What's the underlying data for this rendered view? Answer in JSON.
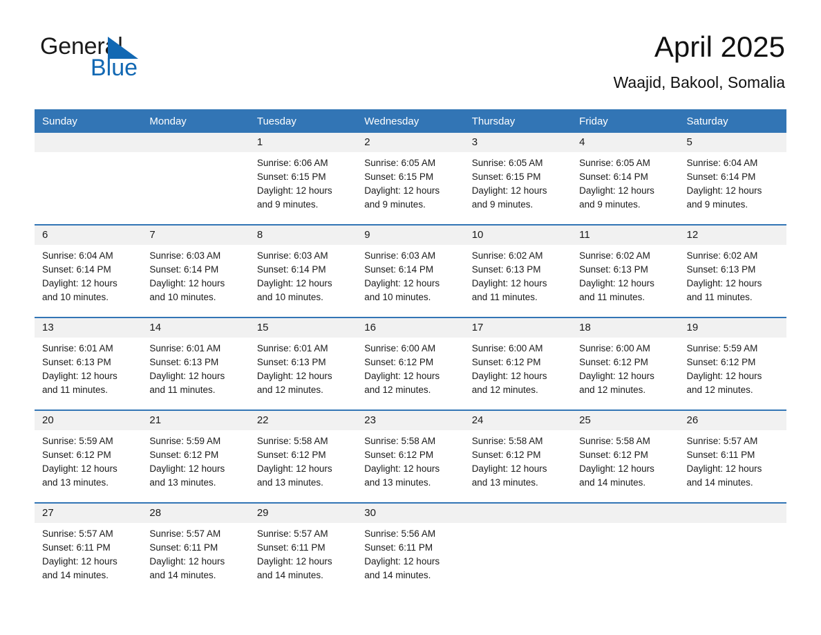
{
  "brand": {
    "name_part1": "General",
    "name_part2": "Blue",
    "triangle_color": "#1268b3",
    "logo_icon": "general-blue-logo"
  },
  "header": {
    "title": "April 2025",
    "subtitle": "Waajid, Bakool, Somalia"
  },
  "theme": {
    "header_blue": "#3275b5",
    "row_divider_blue": "#3275b5",
    "day_number_band": "#f1f1f1",
    "text": "#1a1a1a"
  },
  "weekday_headers": [
    "Sunday",
    "Monday",
    "Tuesday",
    "Wednesday",
    "Thursday",
    "Friday",
    "Saturday"
  ],
  "weeks": [
    [
      {
        "day": "",
        "info": ""
      },
      {
        "day": "",
        "info": ""
      },
      {
        "day": "1",
        "info": "Sunrise: 6:06 AM\nSunset: 6:15 PM\nDaylight: 12 hours\nand 9 minutes."
      },
      {
        "day": "2",
        "info": "Sunrise: 6:05 AM\nSunset: 6:15 PM\nDaylight: 12 hours\nand 9 minutes."
      },
      {
        "day": "3",
        "info": "Sunrise: 6:05 AM\nSunset: 6:15 PM\nDaylight: 12 hours\nand 9 minutes."
      },
      {
        "day": "4",
        "info": "Sunrise: 6:05 AM\nSunset: 6:14 PM\nDaylight: 12 hours\nand 9 minutes."
      },
      {
        "day": "5",
        "info": "Sunrise: 6:04 AM\nSunset: 6:14 PM\nDaylight: 12 hours\nand 9 minutes."
      }
    ],
    [
      {
        "day": "6",
        "info": "Sunrise: 6:04 AM\nSunset: 6:14 PM\nDaylight: 12 hours\nand 10 minutes."
      },
      {
        "day": "7",
        "info": "Sunrise: 6:03 AM\nSunset: 6:14 PM\nDaylight: 12 hours\nand 10 minutes."
      },
      {
        "day": "8",
        "info": "Sunrise: 6:03 AM\nSunset: 6:14 PM\nDaylight: 12 hours\nand 10 minutes."
      },
      {
        "day": "9",
        "info": "Sunrise: 6:03 AM\nSunset: 6:14 PM\nDaylight: 12 hours\nand 10 minutes."
      },
      {
        "day": "10",
        "info": "Sunrise: 6:02 AM\nSunset: 6:13 PM\nDaylight: 12 hours\nand 11 minutes."
      },
      {
        "day": "11",
        "info": "Sunrise: 6:02 AM\nSunset: 6:13 PM\nDaylight: 12 hours\nand 11 minutes."
      },
      {
        "day": "12",
        "info": "Sunrise: 6:02 AM\nSunset: 6:13 PM\nDaylight: 12 hours\nand 11 minutes."
      }
    ],
    [
      {
        "day": "13",
        "info": "Sunrise: 6:01 AM\nSunset: 6:13 PM\nDaylight: 12 hours\nand 11 minutes."
      },
      {
        "day": "14",
        "info": "Sunrise: 6:01 AM\nSunset: 6:13 PM\nDaylight: 12 hours\nand 11 minutes."
      },
      {
        "day": "15",
        "info": "Sunrise: 6:01 AM\nSunset: 6:13 PM\nDaylight: 12 hours\nand 12 minutes."
      },
      {
        "day": "16",
        "info": "Sunrise: 6:00 AM\nSunset: 6:12 PM\nDaylight: 12 hours\nand 12 minutes."
      },
      {
        "day": "17",
        "info": "Sunrise: 6:00 AM\nSunset: 6:12 PM\nDaylight: 12 hours\nand 12 minutes."
      },
      {
        "day": "18",
        "info": "Sunrise: 6:00 AM\nSunset: 6:12 PM\nDaylight: 12 hours\nand 12 minutes."
      },
      {
        "day": "19",
        "info": "Sunrise: 5:59 AM\nSunset: 6:12 PM\nDaylight: 12 hours\nand 12 minutes."
      }
    ],
    [
      {
        "day": "20",
        "info": "Sunrise: 5:59 AM\nSunset: 6:12 PM\nDaylight: 12 hours\nand 13 minutes."
      },
      {
        "day": "21",
        "info": "Sunrise: 5:59 AM\nSunset: 6:12 PM\nDaylight: 12 hours\nand 13 minutes."
      },
      {
        "day": "22",
        "info": "Sunrise: 5:58 AM\nSunset: 6:12 PM\nDaylight: 12 hours\nand 13 minutes."
      },
      {
        "day": "23",
        "info": "Sunrise: 5:58 AM\nSunset: 6:12 PM\nDaylight: 12 hours\nand 13 minutes."
      },
      {
        "day": "24",
        "info": "Sunrise: 5:58 AM\nSunset: 6:12 PM\nDaylight: 12 hours\nand 13 minutes."
      },
      {
        "day": "25",
        "info": "Sunrise: 5:58 AM\nSunset: 6:12 PM\nDaylight: 12 hours\nand 14 minutes."
      },
      {
        "day": "26",
        "info": "Sunrise: 5:57 AM\nSunset: 6:11 PM\nDaylight: 12 hours\nand 14 minutes."
      }
    ],
    [
      {
        "day": "27",
        "info": "Sunrise: 5:57 AM\nSunset: 6:11 PM\nDaylight: 12 hours\nand 14 minutes."
      },
      {
        "day": "28",
        "info": "Sunrise: 5:57 AM\nSunset: 6:11 PM\nDaylight: 12 hours\nand 14 minutes."
      },
      {
        "day": "29",
        "info": "Sunrise: 5:57 AM\nSunset: 6:11 PM\nDaylight: 12 hours\nand 14 minutes."
      },
      {
        "day": "30",
        "info": "Sunrise: 5:56 AM\nSunset: 6:11 PM\nDaylight: 12 hours\nand 14 minutes."
      },
      {
        "day": "",
        "info": ""
      },
      {
        "day": "",
        "info": ""
      },
      {
        "day": "",
        "info": ""
      }
    ]
  ]
}
